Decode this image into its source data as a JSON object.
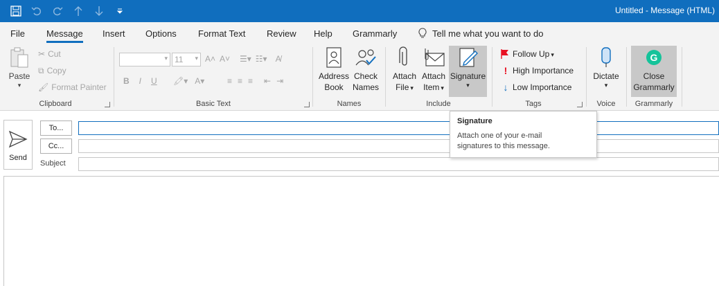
{
  "window": {
    "title": "Untitled  -  Message (HTML)"
  },
  "quick_access": [
    {
      "name": "save-icon",
      "glyph": "💾"
    },
    {
      "name": "undo-icon",
      "glyph": "↶"
    },
    {
      "name": "redo-icon",
      "glyph": "↷"
    },
    {
      "name": "up-arrow-icon",
      "glyph": "↑"
    },
    {
      "name": "down-arrow-icon",
      "glyph": "↓"
    },
    {
      "name": "customize-icon",
      "glyph": "⇟"
    }
  ],
  "menu": {
    "items": [
      "File",
      "Message",
      "Insert",
      "Options",
      "Format Text",
      "Review",
      "Help",
      "Grammarly"
    ],
    "active": "Message",
    "tell_me": "Tell me what you want to do"
  },
  "ribbon": {
    "clipboard": {
      "label": "Clipboard",
      "paste": "Paste",
      "cut": "Cut",
      "copy": "Copy",
      "format_painter": "Format Painter"
    },
    "basic_text": {
      "label": "Basic Text",
      "font_size": "11",
      "bold": "B",
      "italic": "I",
      "underline": "U"
    },
    "names": {
      "label": "Names",
      "address_book": [
        "Address",
        "Book"
      ],
      "check_names": [
        "Check",
        "Names"
      ]
    },
    "include": {
      "label": "Include",
      "attach_file": [
        "Attach",
        "File"
      ],
      "attach_item": [
        "Attach",
        "Item"
      ],
      "signature": "Signature"
    },
    "tags": {
      "label": "Tags",
      "follow_up": "Follow Up",
      "high_importance": "High Importance",
      "low_importance": "Low Importance"
    },
    "voice": {
      "label": "Voice",
      "dictate": "Dictate"
    },
    "grammarly": {
      "label": "Grammarly",
      "close": [
        "Close",
        "Grammarly"
      ]
    }
  },
  "compose": {
    "send": "Send",
    "to": "To...",
    "cc": "Cc...",
    "subject": "Subject"
  },
  "tooltip": {
    "title": "Signature",
    "desc1": "Attach one of your e-mail",
    "desc2": "signatures to this message."
  },
  "colors": {
    "accent": "#106ebe",
    "ribbon_bg": "#f3f3f3",
    "flag_red": "#e81123",
    "grammarly_green": "#15c39a"
  }
}
